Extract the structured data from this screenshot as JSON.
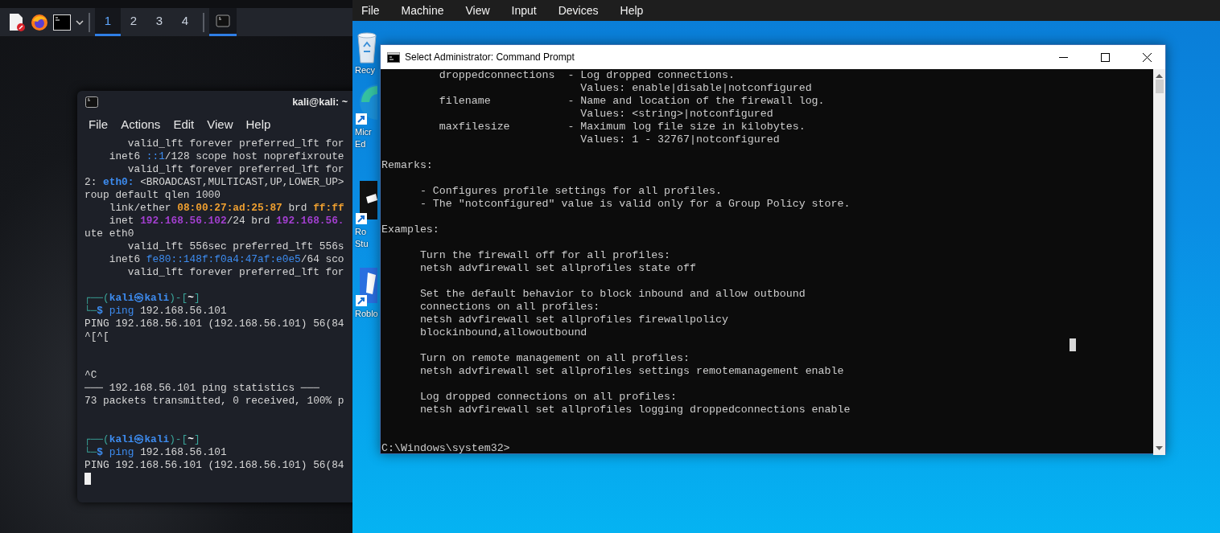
{
  "kali_panel": {
    "launchers": [
      {
        "kind": "editor"
      },
      {
        "kind": "browser"
      },
      {
        "kind": "terminal"
      }
    ],
    "workspaces": [
      {
        "label": "1",
        "selected": true
      },
      {
        "label": "2",
        "selected": false
      },
      {
        "label": "3",
        "selected": false
      },
      {
        "label": "4",
        "selected": false
      }
    ],
    "tasks": [
      {
        "selected": true
      }
    ]
  },
  "kali_terminal": {
    "title": "kali@kali: ~",
    "menu": [
      "File",
      "Actions",
      "Edit",
      "View",
      "Help"
    ],
    "lines": [
      {
        "kind": "text",
        "segments": [
          {
            "text": "       valid_lft forever preferred_lft for",
            "kind": "plain"
          }
        ]
      },
      {
        "kind": "text",
        "segments": [
          {
            "text": "    inet6 ",
            "kind": "plain"
          },
          {
            "text": "::1",
            "kind": "blue"
          },
          {
            "text": "/128 scope host noprefixroute",
            "kind": "plain"
          }
        ]
      },
      {
        "kind": "text",
        "segments": [
          {
            "text": "       valid_lft forever preferred_lft for",
            "kind": "plain"
          }
        ]
      },
      {
        "kind": "text",
        "segments": [
          {
            "text": "2: ",
            "kind": "plain"
          },
          {
            "text": "eth0:",
            "kind": "bold-blue"
          },
          {
            "text": " <BROADCAST,MULTICAST,UP,LOWER_UP>",
            "kind": "plain"
          }
        ]
      },
      {
        "kind": "text",
        "segments": [
          {
            "text": "roup default qlen 1000",
            "kind": "plain"
          }
        ]
      },
      {
        "kind": "text",
        "segments": [
          {
            "text": "    link/ether ",
            "kind": "plain"
          },
          {
            "text": "08:00:27:ad:25:87",
            "kind": "orange"
          },
          {
            "text": " brd ",
            "kind": "plain"
          },
          {
            "text": "ff:ff",
            "kind": "orange"
          }
        ]
      },
      {
        "kind": "text",
        "segments": [
          {
            "text": "    inet ",
            "kind": "plain"
          },
          {
            "text": "192.168.56.102",
            "kind": "purple"
          },
          {
            "text": "/24 brd ",
            "kind": "plain"
          },
          {
            "text": "192.168.56.",
            "kind": "purple"
          }
        ]
      },
      {
        "kind": "text",
        "segments": [
          {
            "text": "ute eth0",
            "kind": "plain"
          }
        ]
      },
      {
        "kind": "text",
        "segments": [
          {
            "text": "       valid_lft 556sec preferred_lft 556s",
            "kind": "plain"
          }
        ]
      },
      {
        "kind": "text",
        "segments": [
          {
            "text": "    inet6 ",
            "kind": "plain"
          },
          {
            "text": "fe80::148f:f0a4:47af:e0e5",
            "kind": "blue"
          },
          {
            "text": "/64 sco",
            "kind": "plain"
          }
        ]
      },
      {
        "kind": "text",
        "segments": [
          {
            "text": "       valid_lft forever preferred_lft for",
            "kind": "plain"
          }
        ]
      },
      {
        "kind": "blank"
      },
      {
        "kind": "text",
        "segments": [
          {
            "text": "┌──(",
            "kind": "teal"
          },
          {
            "text": "kali㉿kali",
            "kind": "bold-blue"
          },
          {
            "text": ")-[",
            "kind": "teal"
          },
          {
            "text": "~",
            "kind": "bold-white"
          },
          {
            "text": "]",
            "kind": "teal"
          }
        ]
      },
      {
        "kind": "text",
        "segments": [
          {
            "text": "└─",
            "kind": "teal"
          },
          {
            "text": "$",
            "kind": "bold-blue"
          },
          {
            "text": " ping",
            "kind": "blue"
          },
          {
            "text": " 192.168.56.101",
            "kind": "plain"
          }
        ]
      },
      {
        "kind": "text",
        "segments": [
          {
            "text": "PING 192.168.56.101 (192.168.56.101) 56(84",
            "kind": "plain"
          }
        ]
      },
      {
        "kind": "text",
        "segments": [
          {
            "text": "^[^[",
            "kind": "plain"
          }
        ]
      },
      {
        "kind": "blank"
      },
      {
        "kind": "blank"
      },
      {
        "kind": "text",
        "segments": [
          {
            "text": "^C",
            "kind": "plain"
          }
        ]
      },
      {
        "kind": "text",
        "segments": [
          {
            "text": "─── 192.168.56.101 ping statistics ───",
            "kind": "plain"
          }
        ]
      },
      {
        "kind": "text",
        "segments": [
          {
            "text": "73 packets transmitted, 0 received, 100% p",
            "kind": "plain"
          }
        ]
      },
      {
        "kind": "blank"
      },
      {
        "kind": "blank"
      },
      {
        "kind": "text",
        "segments": [
          {
            "text": "┌──(",
            "kind": "teal"
          },
          {
            "text": "kali㉿kali",
            "kind": "bold-blue"
          },
          {
            "text": ")-[",
            "kind": "teal"
          },
          {
            "text": "~",
            "kind": "bold-white"
          },
          {
            "text": "]",
            "kind": "teal"
          }
        ]
      },
      {
        "kind": "text",
        "segments": [
          {
            "text": "└─",
            "kind": "teal"
          },
          {
            "text": "$",
            "kind": "bold-blue"
          },
          {
            "text": " ping",
            "kind": "blue"
          },
          {
            "text": " 192.168.56.101",
            "kind": "plain"
          }
        ]
      },
      {
        "kind": "text",
        "segments": [
          {
            "text": "PING 192.168.56.101 (192.168.56.101) 56(84",
            "kind": "plain"
          }
        ]
      },
      {
        "kind": "cursor"
      }
    ]
  },
  "vm_menu": [
    "File",
    "Machine",
    "View",
    "Input",
    "Devices",
    "Help"
  ],
  "desktop_icons": [
    {
      "kind": "recycle-bin",
      "label": [
        "Recy"
      ]
    },
    {
      "kind": "edge",
      "label": [
        "Micr",
        "Ed"
      ]
    },
    {
      "kind": "studio",
      "label": [
        "Ro",
        "Stu"
      ]
    },
    {
      "kind": "roblox",
      "label": [
        "Roblo"
      ]
    }
  ],
  "cmd_window": {
    "title": "Select Administrator: Command Prompt",
    "lines": [
      {
        "kind": "text",
        "text": "         droppedconnections  - Log dropped connections."
      },
      {
        "kind": "text",
        "text": "                               Values: enable|disable|notconfigured"
      },
      {
        "kind": "text",
        "text": "         filename            - Name and location of the firewall log."
      },
      {
        "kind": "text",
        "text": "                               Values: <string>|notconfigured"
      },
      {
        "kind": "text",
        "text": "         maxfilesize         - Maximum log file size in kilobytes."
      },
      {
        "kind": "text",
        "text": "                               Values: 1 - 32767|notconfigured"
      },
      {
        "kind": "blank"
      },
      {
        "kind": "text",
        "text": "Remarks:"
      },
      {
        "kind": "blank"
      },
      {
        "kind": "text",
        "text": "      - Configures profile settings for all profiles."
      },
      {
        "kind": "text",
        "text": "      - The \"notconfigured\" value is valid only for a Group Policy store."
      },
      {
        "kind": "blank"
      },
      {
        "kind": "text",
        "text": "Examples:"
      },
      {
        "kind": "blank"
      },
      {
        "kind": "text",
        "text": "      Turn the firewall off for all profiles:"
      },
      {
        "kind": "text",
        "text": "      netsh advfirewall set allprofiles state off"
      },
      {
        "kind": "blank"
      },
      {
        "kind": "text",
        "text": "      Set the default behavior to block inbound and allow outbound"
      },
      {
        "kind": "text",
        "text": "      connections on all profiles:"
      },
      {
        "kind": "text",
        "text": "      netsh advfirewall set allprofiles firewallpolicy"
      },
      {
        "kind": "text",
        "text": "      blockinbound,allowoutbound"
      },
      {
        "kind": "blank"
      },
      {
        "kind": "text",
        "text": "      Turn on remote management on all profiles:"
      },
      {
        "kind": "text",
        "text": "      netsh advfirewall set allprofiles settings remotemanagement enable"
      },
      {
        "kind": "blank"
      },
      {
        "kind": "text",
        "text": "      Log dropped connections on all profiles:"
      },
      {
        "kind": "text",
        "text": "      netsh advfirewall set allprofiles logging droppedconnections enable"
      },
      {
        "kind": "blank"
      },
      {
        "kind": "blank"
      },
      {
        "kind": "text",
        "text": "C:\\Windows\\system32>"
      }
    ]
  }
}
